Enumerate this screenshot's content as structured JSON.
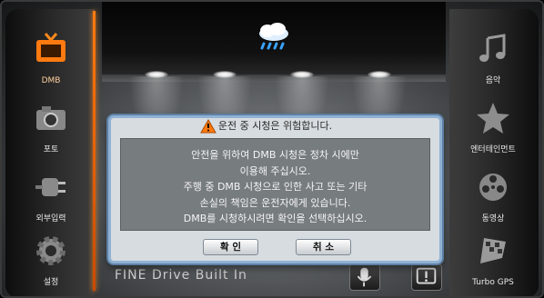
{
  "dialog": {
    "title": "운전 중 시청은 위험합니다.",
    "lines": [
      "안전을 위하여 DMB 시청은 정차 시에만",
      "이용해 주십시오.",
      "주행 중 DMB 시청으로 인한 사고 또는 기타",
      "손실의 책임은 운전자에게 있습니다.",
      "DMB를 시청하시려면 확인을 선택하십시오."
    ],
    "confirm_label": "확 인",
    "cancel_label": "취 소"
  },
  "left_menu": [
    {
      "label": "DMB",
      "icon": "tv-icon",
      "active": true
    },
    {
      "label": "포토",
      "icon": "camera-icon",
      "active": false
    },
    {
      "label": "외부입력",
      "icon": "plug-icon",
      "active": false
    },
    {
      "label": "설정",
      "icon": "gear-icon",
      "active": false
    }
  ],
  "right_menu": [
    {
      "label": "음악",
      "icon": "music-note-icon"
    },
    {
      "label": "엔터테인먼트",
      "icon": "star-icon"
    },
    {
      "label": "동영상",
      "icon": "film-reel-icon"
    },
    {
      "label": "Turbo GPS",
      "icon": "checkered-flag-icon"
    }
  ],
  "bottom": {
    "brand": "FINE Drive Built In",
    "mic_icon": "microphone-icon",
    "alert_icon": "exclamation-icon"
  },
  "weather_icon": "rain-cloud-icon",
  "colors": {
    "accent": "#ff7a10",
    "dialog_border": "#8fb1d3",
    "dialog_body": "#777c7f"
  }
}
